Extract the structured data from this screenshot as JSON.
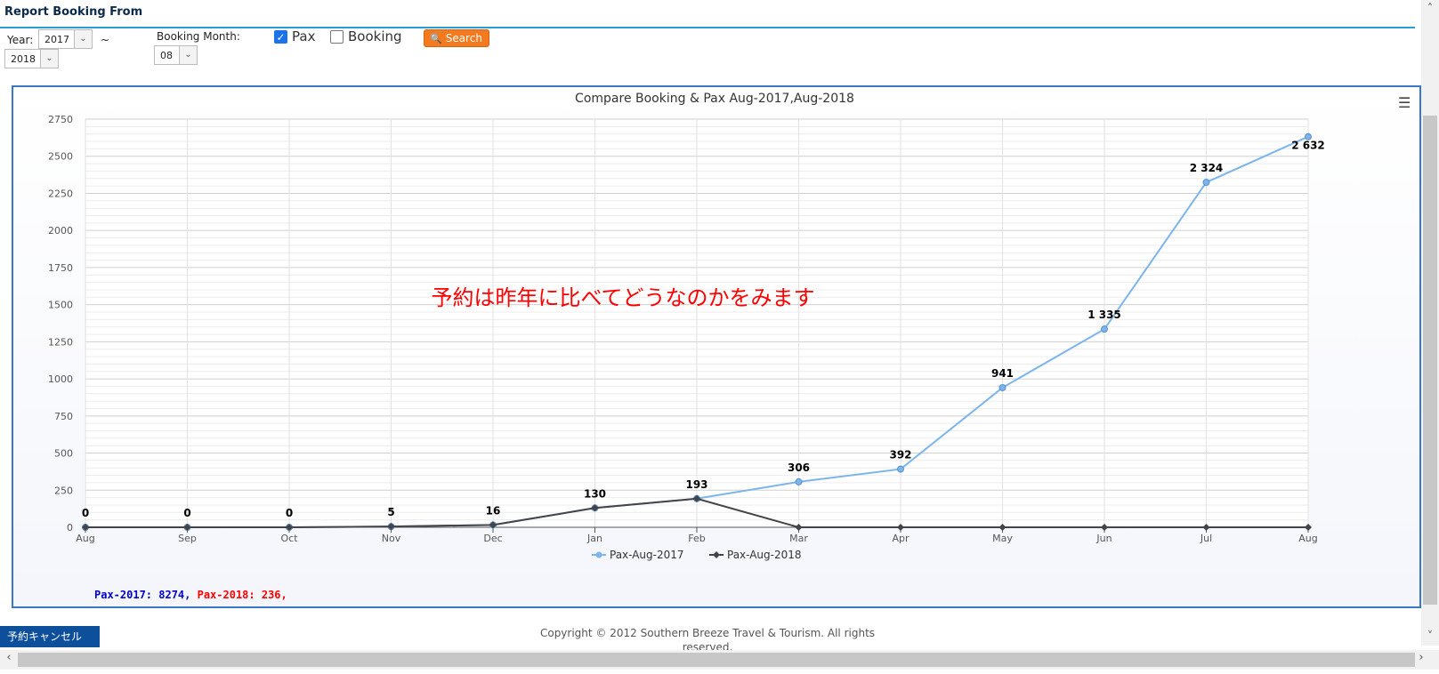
{
  "header": {
    "title": "Report Booking From"
  },
  "filters": {
    "year_label": "Year:",
    "year_from": "2017",
    "tilde": "~",
    "year_to": "2018",
    "booking_month_label": "Booking Month:",
    "booking_month": "08",
    "pax_label": "Pax",
    "pax_checked": true,
    "booking_label": "Booking",
    "booking_checked": false,
    "search_label": "Search"
  },
  "chart": {
    "menu_icon": "hamburger-icon",
    "totals": {
      "pax2017": "Pax-2017: 8274,",
      "pax2018": "Pax-2018: 236,"
    }
  },
  "chart_data": {
    "type": "line",
    "title": "Compare Booking & Pax Aug-2017,Aug-2018",
    "xlabel": "",
    "ylabel": "",
    "categories": [
      "Aug",
      "Sep",
      "Oct",
      "Nov",
      "Dec",
      "Jan",
      "Feb",
      "Mar",
      "Apr",
      "May",
      "Jun",
      "Jul",
      "Aug"
    ],
    "ylim": [
      0,
      2750
    ],
    "yticks": [
      "0",
      "250",
      "500",
      "750",
      "1000",
      "1250",
      "1500",
      "1750",
      "2000",
      "2250",
      "2500",
      "2750"
    ],
    "grid": true,
    "legend": "bottom-center",
    "annotation": "予約は昨年に比べてどうなのかをみます",
    "series": [
      {
        "name": "Pax-Aug-2017",
        "color": "#7cb5ec",
        "marker": "circle",
        "values": [
          0,
          0,
          0,
          5,
          16,
          130,
          193,
          306,
          392,
          941,
          1335,
          2324,
          2632
        ]
      },
      {
        "name": "Pax-Aug-2018",
        "color": "#434348",
        "marker": "diamond",
        "values": [
          0,
          0,
          0,
          5,
          16,
          130,
          193,
          0,
          0,
          0,
          0,
          0,
          0
        ]
      }
    ],
    "data_labels": [
      "0",
      "0",
      "0",
      "5",
      "16",
      "130",
      "193",
      "306",
      "392",
      "941",
      "1 335",
      "2 324",
      "2 632"
    ]
  },
  "footer": {
    "cancel_label": "予約キャンセル",
    "copyright_line1": "Copyright © 2012 Southern Breeze Travel & Tourism. All rights",
    "copyright_line2": "reserved."
  },
  "colors": {
    "accent": "#2a9fd6",
    "chart_border": "#3a78c6",
    "search": "#f47a1f",
    "cancel": "#0e4f9b",
    "total_2017": "#0000cc",
    "total_2018": "#ff0000",
    "annotation": "#ff0000"
  }
}
